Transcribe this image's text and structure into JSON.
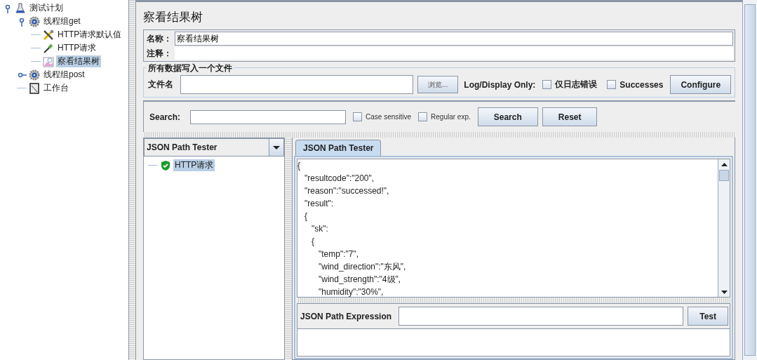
{
  "tree": [
    {
      "label": "测试计划",
      "kind": "plan",
      "expanded": true,
      "selected": false,
      "children": [
        {
          "label": "线程组get",
          "kind": "threadgroup",
          "expanded": true,
          "selected": false,
          "children": [
            {
              "label": "HTTP请求默认值",
              "kind": "config",
              "selected": false
            },
            {
              "label": "HTTP请求",
              "kind": "sampler",
              "selected": false
            },
            {
              "label": "察看结果树",
              "kind": "listener",
              "selected": true
            }
          ]
        },
        {
          "label": "线程组post",
          "kind": "threadgroup",
          "expanded": false,
          "selected": false
        },
        {
          "label": "工作台",
          "kind": "workbench",
          "selected": false
        }
      ]
    }
  ],
  "panel": {
    "title": "察看结果树",
    "name_label": "名称：",
    "name_value": "察看结果树",
    "comment_label": "注释："
  },
  "file_group": {
    "title": "所有数据写入一个文件",
    "file_label": "文件名",
    "browse": "浏览...",
    "log_label": "Log/Display Only:",
    "errors": {
      "label": "仅日志错误",
      "checked": false
    },
    "successes": {
      "label": "Successes",
      "checked": false
    },
    "configure": "Configure"
  },
  "search": {
    "label": "Search:",
    "case_sensitive": {
      "label": "Case sensitive",
      "checked": false
    },
    "regex": {
      "label": "Regular exp.",
      "checked": false
    },
    "search_button": "Search",
    "reset_button": "Reset"
  },
  "renderer": "JSON Path Tester",
  "results": [
    {
      "label": "HTTP请求",
      "kind": "success",
      "selected": true
    }
  ],
  "tab": {
    "label": "JSON Path Tester",
    "selected": true
  },
  "response_lines": [
    "{",
    "   \"resultcode\":\"200\",",
    "   \"reason\":\"successed!\",",
    "   \"result\":",
    "   {",
    "      \"sk\":",
    "      {",
    "         \"temp\":\"7\",",
    "         \"wind_direction\":\"东风\",",
    "         \"wind_strength\":\"4级\",",
    "         \"humidity\":\"30%\","
  ],
  "expression": {
    "label": "JSON Path Expression",
    "test_button": "Test"
  }
}
